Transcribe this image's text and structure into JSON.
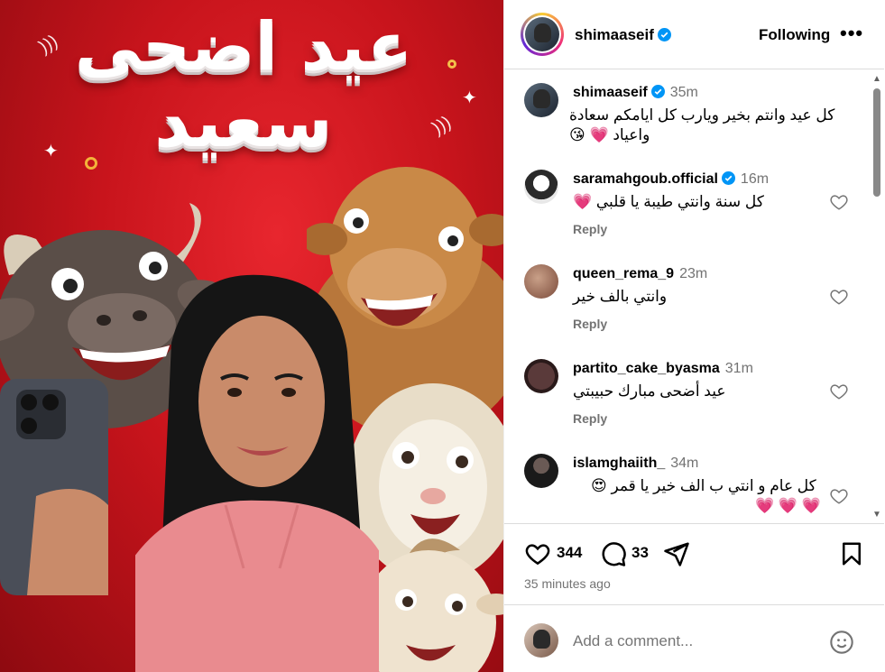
{
  "post_image": {
    "headline_line1": "عيد اضحى",
    "headline_line2": "سعيد"
  },
  "header": {
    "username": "shimaaseif",
    "following_label": "Following",
    "more_label": "•••"
  },
  "caption": {
    "username": "shimaaseif",
    "time": "35m",
    "line1": "كل عيد وانتم بخير ويارب كل ايامكم سعادة",
    "line2": "واعياد 💗 😘"
  },
  "comments": [
    {
      "username": "saramahgoub.official",
      "time": "16m",
      "text": "كل سنة وانتي طيبة يا قلبي 💗",
      "reply": "Reply",
      "verified": true
    },
    {
      "username": "queen_rema_9",
      "time": "23m",
      "text": "وانتي بالف خير",
      "reply": "Reply",
      "verified": false
    },
    {
      "username": "partito_cake_byasma",
      "time": "31m",
      "text": "عيد أضحى مبارك حبيبتي",
      "reply": "Reply",
      "verified": false
    },
    {
      "username": "islamghaiith_",
      "time": "34m",
      "text": "كل عام و انتي ب الف خير يا قمر 😍",
      "text2": "💗 💗 💗",
      "verified": false
    }
  ],
  "actions": {
    "likes": "344",
    "comments_count": "33",
    "posted_ago": "35 minutes ago"
  },
  "add_comment": {
    "placeholder": "Add a comment..."
  },
  "colors": {
    "verified_blue": "#0095f6",
    "secondary_text": "#737373",
    "poster_red": "#d11a22"
  }
}
